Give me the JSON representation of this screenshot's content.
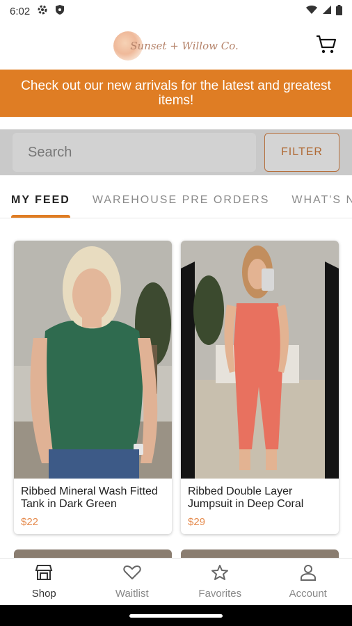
{
  "status_bar": {
    "time": "6:02"
  },
  "header": {
    "logo_text": "Sunset + Willow Co."
  },
  "banner": {
    "text": "Check out our new arrivals for the latest and greatest items!"
  },
  "search": {
    "placeholder": "Search",
    "filter_label": "FILTER"
  },
  "tabs": [
    {
      "label": "MY FEED"
    },
    {
      "label": "WAREHOUSE PRE ORDERS"
    },
    {
      "label": "WHAT'S NEW"
    }
  ],
  "products": [
    {
      "title": "Ribbed Mineral Wash Fitted Tank in Dark Green",
      "price": "$22"
    },
    {
      "title": "Ribbed Double Layer Jumpsuit in Deep Coral",
      "price": "$29"
    }
  ],
  "bottom_nav": [
    {
      "label": "Shop",
      "icon": "shop-icon"
    },
    {
      "label": "Waitlist",
      "icon": "heart-icon"
    },
    {
      "label": "Favorites",
      "icon": "star-icon"
    },
    {
      "label": "Account",
      "icon": "person-icon"
    }
  ],
  "colors": {
    "accent": "#df7d24",
    "price": "#e58a4c"
  }
}
